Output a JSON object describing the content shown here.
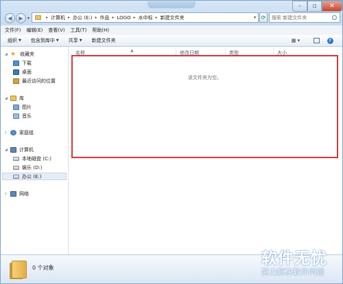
{
  "address": {
    "crumbs": [
      "计算机",
      "办公 (E:)",
      "作品",
      "LOGO",
      "水中标",
      "新建文件夹"
    ]
  },
  "search": {
    "placeholder": "搜索 新建文件夹"
  },
  "menu": [
    "文件(F)",
    "编辑(E)",
    "查看(V)",
    "工具(T)",
    "帮助(H)"
  ],
  "toolbar": {
    "organize": "组织",
    "include_in_library": "包含到库中",
    "share": "共享",
    "new_folder": "新建文件夹"
  },
  "nav": {
    "favorites": "收藏夹",
    "downloads": "下载",
    "desktop": "桌面",
    "recent": "最近访问的位置",
    "library": "库",
    "pictures": "图片",
    "music": "音乐",
    "homegroup": "家庭组",
    "computer": "计算机",
    "local_disk": "本地磁盘 (C:)",
    "entertainment": "娱乐 (D:)",
    "office": "办公 (E:)",
    "network": "网络"
  },
  "columns": {
    "name": "名称",
    "modified": "修改日期",
    "type": "类型",
    "size": "大小"
  },
  "content": {
    "empty_message": "该文件夹为空。"
  },
  "details": {
    "count": "0 个对象"
  },
  "watermark": {
    "logo": "软件无忧",
    "subtitle": "努力解决软件问题"
  },
  "colors": {
    "highlight": "#d93436",
    "window_border": "#7ea3c9"
  }
}
